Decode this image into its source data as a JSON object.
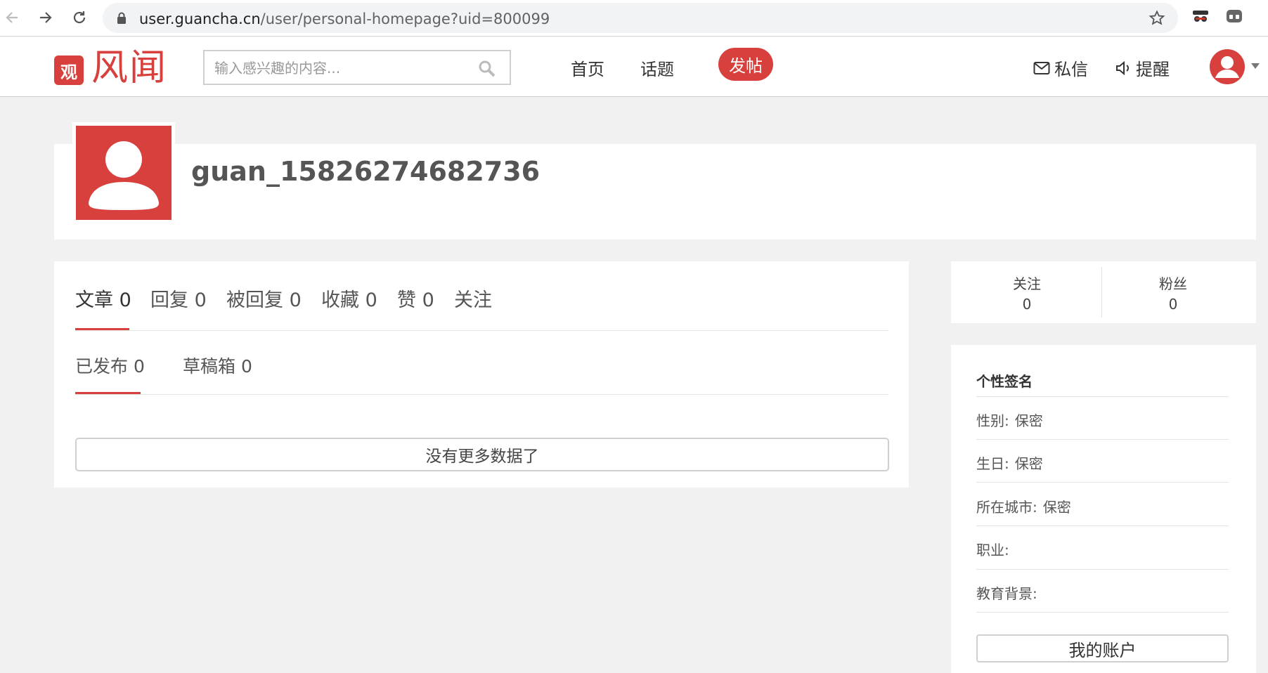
{
  "browser": {
    "url_host": "user.guancha.cn",
    "url_path": "/user/personal-homepage?uid=800099",
    "back_icon": "arrow-left-icon",
    "forward_icon": "arrow-right-icon",
    "reload_icon": "reload-icon",
    "bookmark_icon": "star-icon"
  },
  "header": {
    "logo_badge": "观",
    "logo_text": "风闻",
    "search_placeholder": "输入感兴趣的内容...",
    "nav": [
      "首页",
      "话题"
    ],
    "post_button": "发帖",
    "messages_label": "私信",
    "reminders_label": "提醒"
  },
  "profile": {
    "username": "guan_15826274682736"
  },
  "tabs": [
    {
      "label": "文章",
      "count": "0"
    },
    {
      "label": "回复",
      "count": "0"
    },
    {
      "label": "被回复",
      "count": "0"
    },
    {
      "label": "收藏",
      "count": "0"
    },
    {
      "label": "赞",
      "count": "0"
    },
    {
      "label": "关注",
      "count": ""
    }
  ],
  "subtabs": [
    {
      "label": "已发布",
      "count": "0"
    },
    {
      "label": "草稿箱",
      "count": "0"
    }
  ],
  "no_more_label": "没有更多数据了",
  "stats": {
    "following_label": "关注",
    "following_count": "0",
    "followers_label": "粉丝",
    "followers_count": "0"
  },
  "info": {
    "title": "个性签名",
    "rows": [
      {
        "label": "性别:",
        "value": "保密"
      },
      {
        "label": "生日:",
        "value": "保密"
      },
      {
        "label": "所在城市:",
        "value": "保密"
      },
      {
        "label": "职业:",
        "value": ""
      },
      {
        "label": "教育背景:",
        "value": ""
      }
    ],
    "account_button": "我的账户"
  },
  "colors": {
    "accent": "#d7403c",
    "background": "#f1f1f1"
  }
}
